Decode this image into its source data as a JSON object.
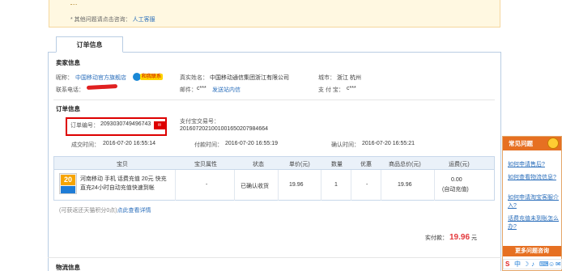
{
  "notice": {
    "other_text": "* 其他问题请点击咨询：",
    "service_link": "人工客服"
  },
  "tab": {
    "label": "订单信息"
  },
  "seller": {
    "section_title": "卖家信息",
    "nickname_label": "昵称：",
    "nickname": "中国移动官方旗舰店",
    "contact_badge": "和我联系",
    "realname_label": "真实姓名：",
    "realname": "中国移动通信集团浙江有限公司",
    "city_label": "城市：",
    "city": "浙江 杭州",
    "phone_label": "联系电话：",
    "email_label": "邮件：",
    "email": "c***",
    "email_link": "发送站内信",
    "alipay_label": "支 付 宝：",
    "alipay": "c***"
  },
  "order": {
    "section_title": "订单信息",
    "order_no_label": "订单编号：",
    "order_no": "2093030749496743",
    "alipay_tx_label": "支付宝交易号：",
    "alipay_tx": "2016072021001001650207984664",
    "created_label": "成交时间：",
    "created": "2016-07-20 16:55:14",
    "paid_label": "付款时间：",
    "paid_time": "2016-07-20 16:55:19",
    "confirm_label": "确认时间：",
    "confirm_time": "2016-07-20 16:55:21"
  },
  "table": {
    "headers": [
      "宝贝",
      "宝贝属性",
      "状态",
      "单价(元)",
      "数量",
      "优惠",
      "商品总价(元)",
      "运费(元)"
    ],
    "row": {
      "title_line1": "河南移动 手机 话费充值 20元 快充",
      "title_line2": "直充24小时自动充值快速到帐",
      "thumb_text": "20",
      "attr": "-",
      "status": "已确认收货",
      "price": "19.96",
      "qty": "1",
      "discount": "-",
      "total": "19.96",
      "shipping": "0.00",
      "shipping_note": "(自动充值)"
    }
  },
  "footer": {
    "note": "(可获返还天猫积分0点)",
    "detail_link": "点此查看详情",
    "paid_label": "实付款：",
    "paid_amount": "19.96",
    "paid_unit": "元"
  },
  "logistics": {
    "section_title": "物流信息"
  },
  "widget": {
    "title": "常见问题",
    "q1": "如何申请售后?",
    "q2": "如何查看物流信息?",
    "q3": "如何申请淘宝客服介入?",
    "q4": "话费充值未到账怎么办?",
    "more": "更多问题咨询",
    "toolbar": [
      "S",
      "中",
      "☽",
      "♪",
      "⌨",
      "☺",
      "✉"
    ]
  },
  "colors": {
    "accent_orange": "#e67022",
    "link_blue": "#2a6ebb",
    "price_red": "#e4393c",
    "highlight_red": "#dd0000"
  }
}
